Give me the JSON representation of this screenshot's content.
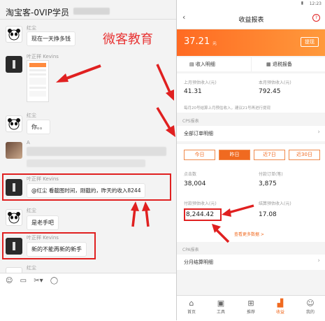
{
  "chat": {
    "title": "淘宝客-0VIP学员",
    "messages": [
      {
        "sender": "红尘",
        "text": "现在一天挣多钱"
      },
      {
        "sender": "叶正祥 Kevins",
        "type": "screenshot"
      },
      {
        "sender": "红尘",
        "text": "你。。"
      },
      {
        "sender": "A",
        "type": "blurred"
      },
      {
        "sender": "叶正祥 Kevins",
        "text": "@红尘 看截图时间，刚截的，昨天的收入8244"
      },
      {
        "sender": "红尘",
        "text": "是老手吧"
      },
      {
        "sender": "叶正祥 Kevins",
        "text": "新的不能再新的新手"
      },
      {
        "sender": "红尘"
      }
    ],
    "watermark": "微客教育",
    "toolbar_icons": [
      "emoji-icon",
      "folder-icon",
      "scissors-icon",
      "chat-bubble-icon"
    ]
  },
  "app": {
    "status_time": "12:23",
    "title": "收益报表",
    "help_icon": "?",
    "balance": "37.21",
    "balance_unit": "元",
    "withdraw_label": "提现",
    "income_detail_label": "收入明细",
    "refund_report_label": "退税报备",
    "last_month_label": "上月预估收入(元)",
    "last_month_value": "41.31",
    "this_month_label": "本月预估收入(元)",
    "this_month_value": "792.45",
    "notice": "每月20号结算上月预估收入，建议21号再进行提现",
    "cps_section": "CPS报表",
    "all_orders_label": "全部订单明细",
    "tabs": [
      "今日",
      "昨日",
      "近7日",
      "近30日"
    ],
    "active_tab": "昨日",
    "clicks_label": "点击数",
    "clicks_value": "38,004",
    "paid_orders_label": "付款订单(笔)",
    "paid_orders_value": "3,875",
    "est_income_label": "付款预估收入(元)",
    "est_income_value": "8,244.42",
    "settle_income_label": "结算预估收入(元)",
    "settle_income_value": "17.08",
    "more_data_label": "查看更多数据 >",
    "cpa_section": "CPA报表",
    "monthly_settle_label": "分月结算明细",
    "bottom_nav": [
      "首页",
      "工具",
      "推荐",
      "收益",
      "我的"
    ],
    "bottom_nav_active": "收益"
  },
  "colors": {
    "accent": "#f06a20",
    "annotation_red": "#e02020"
  }
}
